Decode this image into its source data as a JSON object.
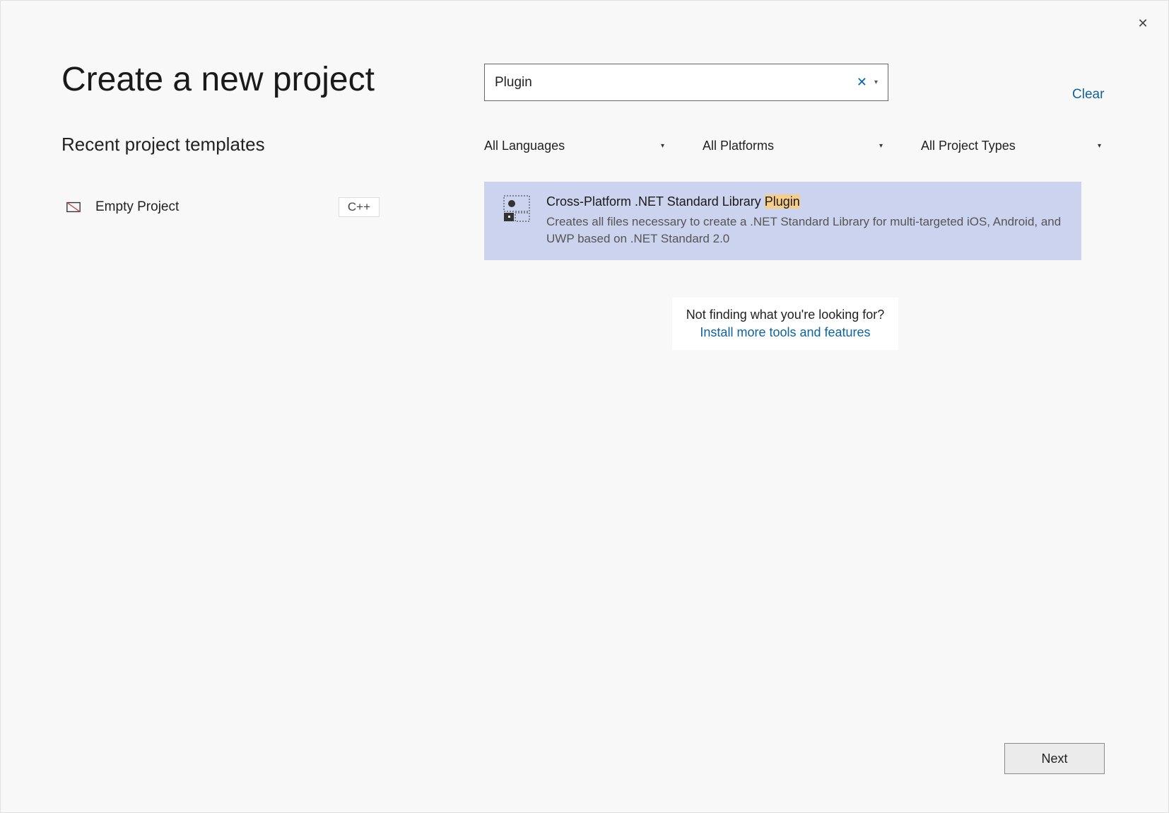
{
  "window": {
    "title": "Create a new project",
    "close": "✕"
  },
  "search": {
    "value": "Plugin",
    "clear_x": "✕",
    "dropdown_glyph": "▾",
    "clear_link": "Clear"
  },
  "recent": {
    "title": "Recent project templates",
    "items": [
      {
        "name": "Empty Project",
        "language": "C++"
      }
    ]
  },
  "filters": {
    "language": {
      "label": "All Languages",
      "arrow": "▾"
    },
    "platform": {
      "label": "All Platforms",
      "arrow": "▾"
    },
    "type": {
      "label": "All Project Types",
      "arrow": "▾"
    }
  },
  "templates": [
    {
      "title_prefix": "Cross-Platform .NET Standard Library ",
      "title_highlight": "Plugin",
      "description": "Creates all files necessary to create a .NET Standard Library for multi-targeted iOS, Android, and UWP based on .NET Standard 2.0",
      "selected": true
    }
  ],
  "not_finding": {
    "text": "Not finding what you're looking for?",
    "link": "Install more tools and features"
  },
  "buttons": {
    "next": "Next"
  }
}
